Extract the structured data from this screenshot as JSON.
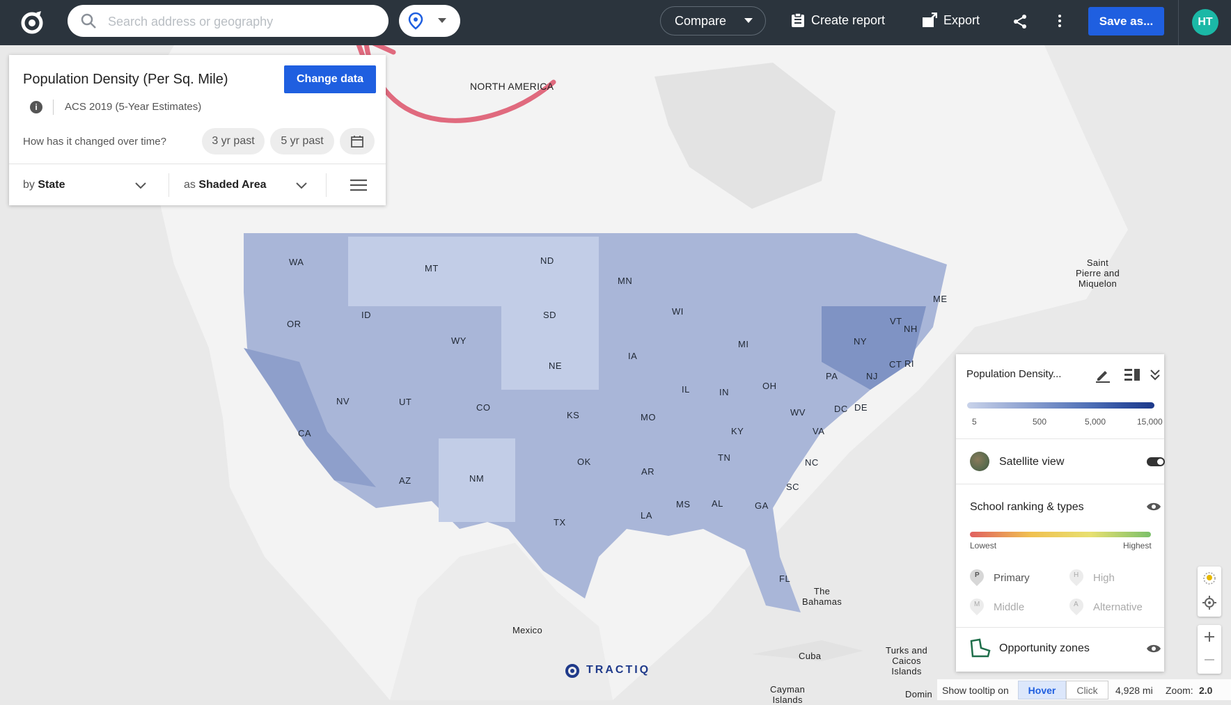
{
  "topbar": {
    "search_placeholder": "Search address or geography",
    "compare_label": "Compare",
    "create_report_label": "Create report",
    "export_label": "Export",
    "save_label": "Save as...",
    "avatar_initials": "HT"
  },
  "data_panel": {
    "title": "Population Density (Per Sq. Mile)",
    "change_data_label": "Change data",
    "info_icon": "i",
    "source": "ACS 2019 (5-Year Estimates)",
    "change_question": "How has it changed over time?",
    "past_3_label": "3 yr past",
    "past_5_label": "5 yr past",
    "by_prefix": "by",
    "by_value": "State",
    "as_prefix": "as",
    "as_value": "Shaded Area"
  },
  "map_labels": {
    "continent": "NORTH AMERICA",
    "saint_pierre": "Saint\nPierre and\nMiquelon",
    "bahamas": "The\nBahamas",
    "mexico": "Mexico",
    "cuba": "Cuba",
    "turks": "Turks and\nCaicos\nIslands",
    "cayman": "Cayman\nIslands",
    "domin": "Domin"
  },
  "states": [
    "WA",
    "MT",
    "ND",
    "MN",
    "OR",
    "ID",
    "SD",
    "WI",
    "MI",
    "NY",
    "VT",
    "NH",
    "ME",
    "WY",
    "IA",
    "NE",
    "IL",
    "IN",
    "OH",
    "PA",
    "NJ",
    "CT",
    "RI",
    "NV",
    "UT",
    "CO",
    "KS",
    "MO",
    "CA",
    "KY",
    "WV",
    "VA",
    "DC",
    "DE",
    "AZ",
    "NM",
    "OK",
    "AR",
    "TN",
    "NC",
    "SC",
    "TX",
    "MS",
    "AL",
    "GA",
    "LA",
    "FL"
  ],
  "legend": {
    "title": "Population Density...",
    "ticks": [
      "5",
      "500",
      "5,000",
      "15,000"
    ],
    "satellite_label": "Satellite view",
    "school_label": "School ranking & types",
    "lowest_label": "Lowest",
    "highest_label": "Highest",
    "school_types": [
      {
        "letter": "P",
        "label": "Primary"
      },
      {
        "letter": "H",
        "label": "High"
      },
      {
        "letter": "M",
        "label": "Middle"
      },
      {
        "letter": "A",
        "label": "Alternative"
      }
    ],
    "opportunity_label": "Opportunity zones",
    "colors": {
      "low": "#c9d3ea",
      "high": "#1d3a8a"
    }
  },
  "statusbar": {
    "tooltip_label": "Show tooltip on",
    "hover_label": "Hover",
    "click_label": "Click",
    "scale": "4,928 mi",
    "zoom_label": "Zoom:",
    "zoom_value": "2.0"
  },
  "brand": {
    "name": "TRACTIQ"
  }
}
